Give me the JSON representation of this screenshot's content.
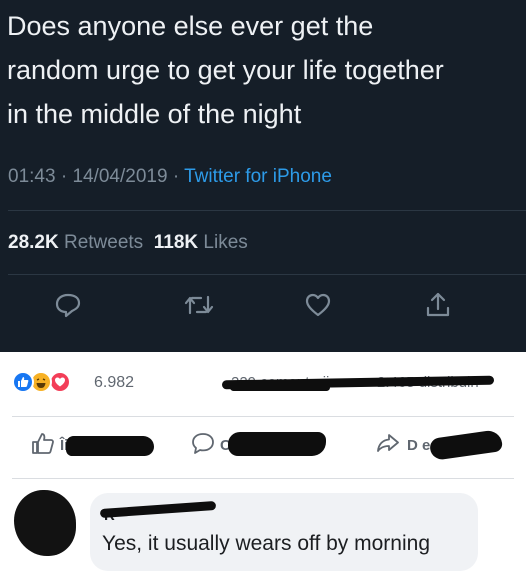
{
  "tweet": {
    "lines": [
      "Does anyone else ever get the",
      "random urge to get your life together",
      "in the middle of the night"
    ],
    "time": "01:43",
    "date": "14/04/2019",
    "separator": "·",
    "source": "Twitter for iPhone",
    "retweets_count": "28.2K",
    "retweets_label": "Retweets",
    "likes_count": "118K",
    "likes_label": "Likes",
    "actions": [
      "reply-icon",
      "retweet-icon",
      "like-icon",
      "share-icon"
    ],
    "colors": {
      "background": "#151e28",
      "accent": "#2d9be8",
      "muted": "#7d8b98"
    }
  },
  "facebook": {
    "reactions": [
      "like-reaction-icon",
      "haha-reaction-icon",
      "love-reaction-icon"
    ],
    "reaction_count": "6.982",
    "comments_count_visible": "229 comentarii",
    "shares_count_visible": "2.465 distribuiri",
    "buttons": {
      "like_visible": "Îi",
      "comment_visible": "C ă",
      "share_visible": "D e"
    },
    "comment": {
      "author_visible": "R",
      "text": "Yes, it usually wears off by morning"
    },
    "colors": {
      "like_blue": "#1877f2",
      "love_red": "#f33e58",
      "haha_yellow": "#f7b125"
    }
  }
}
